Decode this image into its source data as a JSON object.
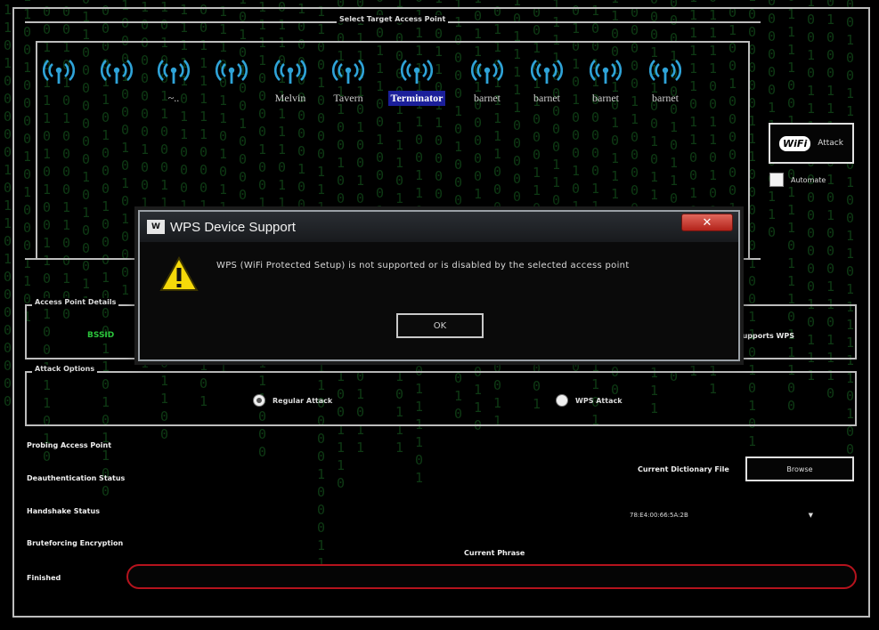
{
  "window": {
    "access_point_group_title": "Select Target Access Point",
    "access_points": [
      {
        "name": ""
      },
      {
        "name": ""
      },
      {
        "name": "~.."
      },
      {
        "name": ""
      },
      {
        "name": "Melvin"
      },
      {
        "name": "Tavern"
      },
      {
        "name": "Terminator",
        "selected": true
      },
      {
        "name": "barnet"
      },
      {
        "name": "barnet"
      },
      {
        "name": "barnet"
      },
      {
        "name": "barnet"
      }
    ],
    "attack_button_label": "Attack",
    "attack_button_badge": "WiFi",
    "automate_label": "Automate",
    "access_point_details_title": "Access Point Details",
    "bssid_label": "BSSID",
    "supports_wps_text": "Supports WPS",
    "attack_options_title": "Attack Options",
    "regular_attack_label": "Regular Attack",
    "wps_attack_label": "WPS Attack",
    "status_labels": {
      "probing": "Probing Access Point",
      "deauth": "Deauthentication Status",
      "handshake": "Handshake Status",
      "bruteforce": "Bruteforcing Encryption",
      "finished": "Finished"
    },
    "dictionary_label": "Current Dictionary File",
    "browse_label": "Browse",
    "mac_value": "78:E4:00:66:5A:2B",
    "current_phrase_label": "Current Phrase"
  },
  "dialog": {
    "title": "WPS Device Support",
    "app_icon_text": "W",
    "close_glyph": "✕",
    "message": "WPS (WiFi Protected Setup) is not supported or is disabled by the selected access point",
    "ok_label": "OK"
  },
  "colors": {
    "wifi_icon": "#2fa3d8",
    "selected_highlight": "#1b1f9a",
    "bssid_green": "#2bc43b",
    "phrase_border": "#b5131d",
    "matrix_green": "#0e3a14"
  }
}
